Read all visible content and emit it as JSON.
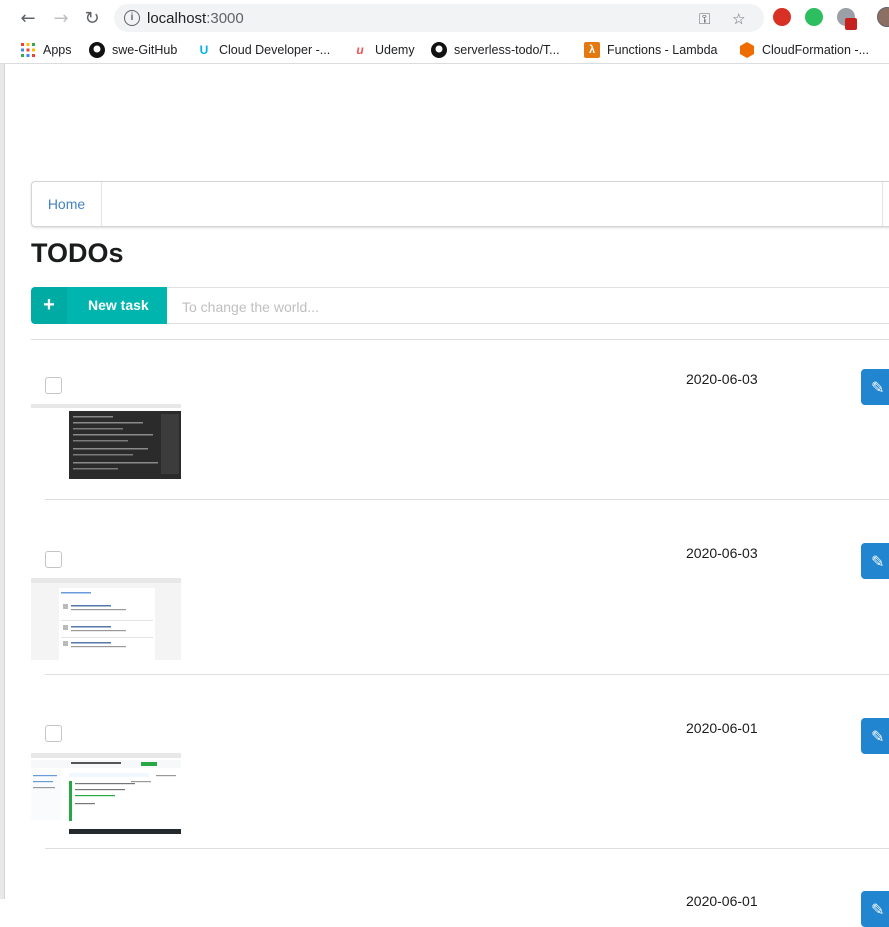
{
  "browser": {
    "url_host": "localhost",
    "url_port": ":3000",
    "bookmarks": [
      {
        "label": "Apps",
        "icon": "apps-grid-icon",
        "color": "#4285f4"
      },
      {
        "label": "swe-GitHub",
        "icon": "github-icon",
        "color": "#000000"
      },
      {
        "label": "Cloud Developer -...",
        "icon": "udacity-icon",
        "color": "#02b3e4"
      },
      {
        "label": "Udemy",
        "icon": "udemy-icon",
        "color": "#ec5252"
      },
      {
        "label": "serverless-todo/T...",
        "icon": "github-icon",
        "color": "#000000"
      },
      {
        "label": "Functions - Lambda",
        "icon": "aws-lambda-icon",
        "color": "#e47911"
      },
      {
        "label": "CloudFormation -...",
        "icon": "cloudformation-icon",
        "color": "#ef6c00"
      }
    ]
  },
  "menu": {
    "home_label": "Home"
  },
  "page": {
    "title": "TODOs",
    "new_task_label": "New task",
    "new_task_placeholder": "To change the world..."
  },
  "todos": [
    {
      "date": "2020-06-03",
      "done": false,
      "thumbnail": "terminal-screenshot"
    },
    {
      "date": "2020-06-03",
      "done": false,
      "thumbnail": "list-screenshot"
    },
    {
      "date": "2020-06-01",
      "done": false,
      "thumbnail": "github-screenshot"
    },
    {
      "date": "2020-06-01",
      "done": false,
      "thumbnail": "partial"
    }
  ],
  "colors": {
    "teal": "#00b5ad",
    "blue": "#2185d0",
    "link": "#4183c4"
  }
}
